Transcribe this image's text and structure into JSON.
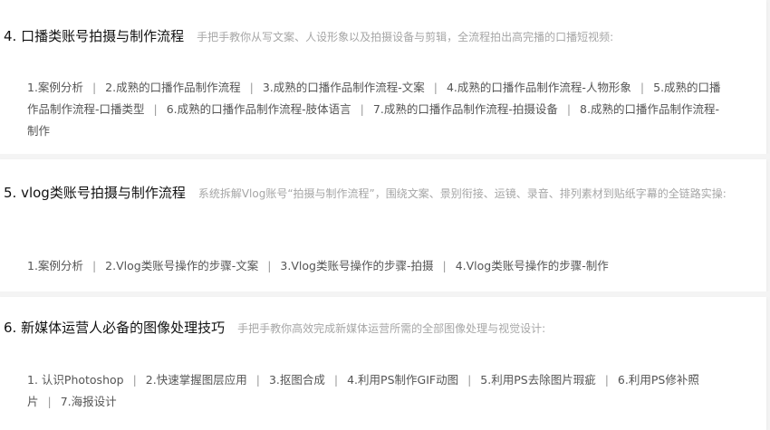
{
  "sections": [
    {
      "title": "4. 口播类账号拍摄与制作流程",
      "description": "手把手教你从写文案、人设形象以及拍摄设备与剪辑，全流程拍出高完播的口播短视频:",
      "links": [
        "1.案例分析",
        "2.成熟的口播作品制作流程",
        "3.成熟的口播作品制作流程-文案",
        "4.成熟的口播作品制作流程-人物形象",
        "5.成熟的口播作品制作流程-口播类型",
        "6.成熟的口播作品制作流程-肢体语言",
        "7.成熟的口播作品制作流程-拍摄设备",
        "8.成熟的口播作品制作流程-制作"
      ]
    },
    {
      "title": "5. vlog类账号拍摄与制作流程",
      "description": "系统拆解Vlog账号“拍摄与制作流程”，围绕文案、景别衔接、运镜、录音、排列素材到贴纸字幕的全链路实操:",
      "links": [
        "1.案例分析",
        "2.Vlog类账号操作的步骤-文案",
        "3.Vlog类账号操作的步骤-拍摄",
        "4.Vlog类账号操作的步骤-制作"
      ]
    },
    {
      "title": "6. 新媒体运营人必备的图像处理技巧",
      "description": "手把手教你高效完成新媒体运营所需的全部图像处理与视觉设计:",
      "links": [
        "1. 认识Photoshop",
        "2.快速掌握图层应用",
        "3.抠图合成",
        "4.利用PS制作GIF动图",
        "5.利用PS去除图片瑕疵",
        "6.利用PS修补照片",
        "7.海报设计"
      ]
    }
  ]
}
